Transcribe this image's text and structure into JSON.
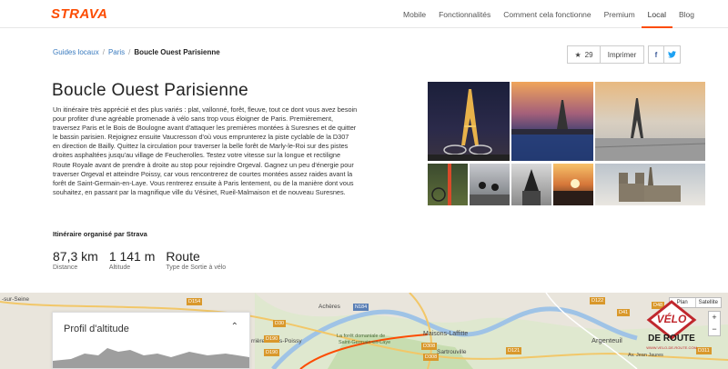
{
  "header": {
    "logo": "STRAVA",
    "nav": [
      "Mobile",
      "Fonctionnalités",
      "Comment cela fonctionne",
      "Premium",
      "Local",
      "Blog"
    ],
    "active_nav": "Local"
  },
  "breadcrumb": {
    "items": [
      "Guides locaux",
      "Paris"
    ],
    "current": "Boucle Ouest Parisienne"
  },
  "actions": {
    "star_count": "29",
    "print_label": "Imprimer",
    "facebook_glyph": "f",
    "twitter_glyph": "🐦"
  },
  "route": {
    "title": "Boucle Ouest Parisienne",
    "description": "Un itinéraire très apprécié et des plus variés : plat, vallonné, forêt, fleuve, tout ce dont vous avez besoin pour profiter d'une agréable promenade à vélo sans trop vous éloigner de Paris. Premièrement, traversez Paris et le Bois de Boulogne avant d'attaquer les premières montées à Suresnes et de quitter le bassin parisien. Rejoignez ensuite Vaucresson d'où vous emprunterez la piste cyclable de la D307 en direction de Bailly. Quittez la circulation pour traverser la belle forêt de Marly-le-Roi sur des pistes droites asphaltées jusqu'au village de Feucherolles. Testez votre vitesse sur la longue et rectiligne Route Royale avant de prendre à droite au stop pour rejoindre Orgeval. Gagnez un peu d'énergie pour traverser Orgeval et atteindre Poissy, car vous rencontrerez de courtes montées assez raides avant la forêt de Saint-Germain-en-Laye. Vous rentrerez ensuite à Paris lentement, ou de la manière dont vous souhaitez, en passant par la magnifique ville du Vésinet, Rueil-Malmaison et de nouveau Suresnes.",
    "organizer": "Itinéraire organisé par Strava",
    "stats": [
      {
        "value": "87,3 km",
        "label": "Distance"
      },
      {
        "value": "1 141 m",
        "label": "Altitude"
      },
      {
        "value": "Route",
        "label": "Type de Sortie à vélo"
      }
    ]
  },
  "map": {
    "profile_title": "Profil d'altitude",
    "controls": [
      "Plan",
      "Satellite"
    ],
    "labels": {
      "l1": "-sur-Seine",
      "l2": "Achères",
      "l3": "Maisons-Laffitte",
      "l4": "Sartrouville",
      "l5": "Argenteuil",
      "l6": "La forêt domaniale de",
      "l7": "Saint-Germain-en-Laye",
      "l8": "rrières-sous-Poissy",
      "l9": "Av. Jean Jaures"
    },
    "roads": [
      "D154",
      "D30",
      "D190",
      "D190",
      "N184",
      "D308",
      "D308",
      "D122",
      "D41",
      "D311",
      "D48",
      "D121"
    ],
    "watermark": {
      "top": "VÉLO",
      "bottom": "DE ROUTE",
      "url": "WWW.VELO-DE-ROUTE.COM"
    }
  },
  "colors": {
    "brand": "#fc4c02",
    "link": "#3a7bbf"
  }
}
